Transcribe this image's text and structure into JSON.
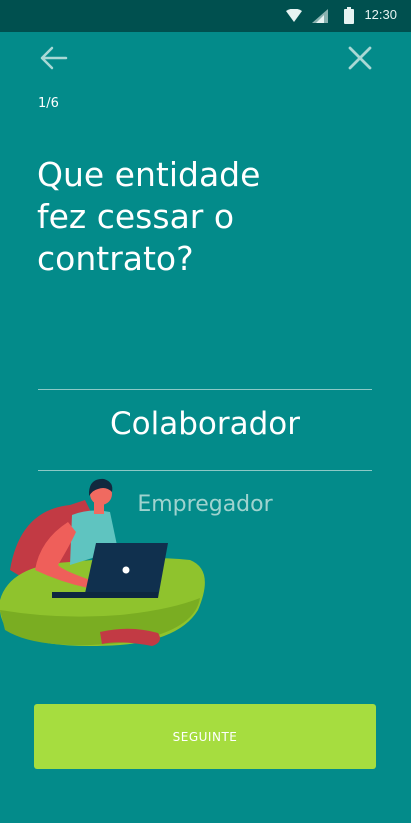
{
  "status_bar": {
    "time": "12:30"
  },
  "header": {
    "step": "1/6"
  },
  "question": {
    "lines": [
      "Que entidade",
      "fez cessar o",
      "contrato?"
    ]
  },
  "options": {
    "selected": "Colaborador",
    "other": "Empregador"
  },
  "footer": {
    "next_label": "SEGUINTE"
  },
  "colors": {
    "background": "#038b8a",
    "status_bar": "#00504f",
    "button": "#a6dd3f"
  }
}
